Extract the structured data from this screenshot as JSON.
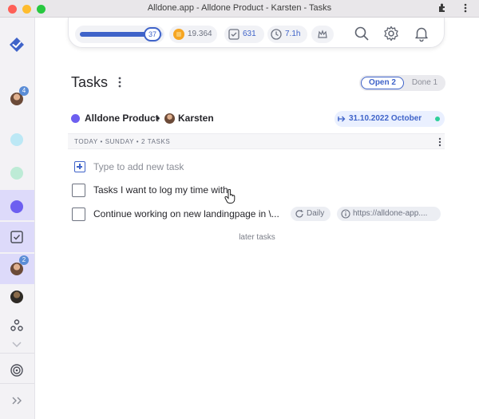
{
  "window": {
    "title": "Alldone.app - Alldone Product - Karsten - Tasks"
  },
  "sidebar": {
    "badge_top": "4",
    "badge_user": "2",
    "project_colors": [
      "#bce8f5",
      "#bdebd6",
      "#6d5ff0"
    ]
  },
  "stats": {
    "level": "37",
    "progress_fraction": 0.82,
    "gold": "19.364",
    "tasks_done": "631",
    "time": "7.1h"
  },
  "main": {
    "title": "Tasks",
    "segments": {
      "open": "Open 2",
      "done": "Done 1"
    },
    "project_name": "Alldone Product",
    "separator": "•",
    "user_name": "Karsten",
    "date": "31.10.2022 October",
    "section": "TODAY • SUNDAY • 2 TASKS",
    "add_placeholder": "Type to add new task",
    "tasks": [
      {
        "text": "Tasks I want to log my time with"
      },
      {
        "text": "Continue working on new landingpage in \\...",
        "recurrence": "Daily",
        "link": "https://alldone-app...."
      }
    ],
    "later": "later tasks"
  },
  "colors": {
    "accent": "#3f63c9",
    "project": "#6d5ff0",
    "status": "#2fd09a"
  }
}
